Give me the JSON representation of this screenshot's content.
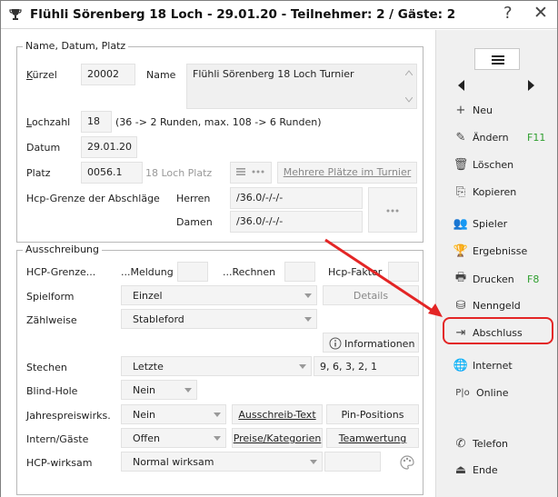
{
  "window": {
    "title": "Flühli Sörenberg 18 Loch - 29.01.20 - Teilnehmer: 2 / Gäste: 2",
    "help_glyph": "?",
    "close_glyph": "✕"
  },
  "section1": {
    "legend": "Name, Datum, Platz",
    "kuerzel": {
      "label_u": "K",
      "label_rest": "ürzel",
      "value": "20002"
    },
    "name": {
      "label": "Name",
      "value": "Flühli Sörenberg 18 Loch Turnier"
    },
    "lochzahl": {
      "label_u": "L",
      "label_rest": "ochzahl",
      "value": "18",
      "hint": "(36 -> 2 Runden, max. 108 -> 6 Runden)"
    },
    "datum": {
      "label": "Datum",
      "value": "29.01.20"
    },
    "platz": {
      "label": "Platz",
      "value": "0056.1",
      "hint": "18 Loch Platz",
      "multi_button": "Mehrere Plätze im Turnier"
    },
    "hcp_grenze": {
      "label": "Hcp-Grenze der Abschläge",
      "herren_label": "Herren",
      "herren_value": "/36.0/-/-/-",
      "damen_label": "Damen",
      "damen_value": "/36.0/-/-/-"
    }
  },
  "section2": {
    "legend": "Ausschreibung",
    "hcp_grenze_label": "HCP-Grenze...",
    "meldung_label": "...Meldung",
    "rechnen_label": "...Rechnen",
    "hcp_faktor_label": "Hcp-Faktor",
    "spielform": {
      "label": "Spielform",
      "value": "Einzel",
      "details_button": "Details"
    },
    "zaehlweise": {
      "label": "Zählweise",
      "value": "Stableford"
    },
    "informationen_button": "Informationen",
    "stechen": {
      "label": "Stechen",
      "value": "Letzte",
      "holes": "9, 6, 3, 2, 1"
    },
    "blind_hole": {
      "label": "Blind-Hole",
      "value": "Nein"
    },
    "jahrespreis": {
      "label": "Jahrespreiswirks.",
      "value": "Nein",
      "button": "Ausschreib-Text",
      "button2": "Pin-Positions"
    },
    "intern_gaeste": {
      "label": "Intern/Gäste",
      "value": "Offen",
      "button": "Preise/Kategorien",
      "button2": "Teamwertung"
    },
    "hcp_wirksam": {
      "label": "HCP-wirksam",
      "value": "Normal wirksam"
    }
  },
  "sidebar": {
    "items": [
      {
        "label": "Neu",
        "icon": "plus-icon",
        "glyph": "+"
      },
      {
        "label": "Ändern",
        "icon": "pencil-icon",
        "glyph": "✎",
        "shortcut": "F11"
      },
      {
        "label": "Löschen",
        "icon": "trash-icon",
        "glyph": "🗑"
      },
      {
        "label": "Kopieren",
        "icon": "copy-icon",
        "glyph": "⎘"
      },
      {
        "label": "Spieler",
        "icon": "players-icon",
        "glyph": "👥"
      },
      {
        "label": "Ergebnisse",
        "icon": "trophy-icon",
        "glyph": "🏆"
      },
      {
        "label": "Drucken",
        "icon": "printer-icon",
        "glyph": "🖶",
        "shortcut": "F8"
      },
      {
        "label": "Nenngeld",
        "icon": "coins-icon",
        "glyph": "⛁"
      },
      {
        "label": "Abschluss",
        "icon": "finish-icon",
        "glyph": "⇥"
      },
      {
        "label": "Internet",
        "icon": "globe-icon",
        "glyph": "🌐"
      },
      {
        "label": "Online",
        "icon": "pio-icon",
        "glyph": "P|o"
      },
      {
        "label": "Telefon",
        "icon": "phone-icon",
        "glyph": "✆"
      },
      {
        "label": "Ende",
        "icon": "exit-icon",
        "glyph": "⏏"
      }
    ]
  },
  "colors": {
    "highlight": "#e32525",
    "shortcut": "#2e9e2e",
    "arrow": "#e32525"
  }
}
